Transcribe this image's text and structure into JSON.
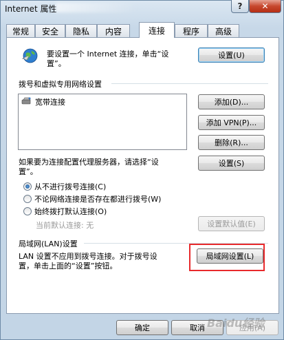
{
  "window": {
    "title": "Internet 属性",
    "help_label": "?",
    "close_label": "✕"
  },
  "tabs": [
    {
      "label": "常规"
    },
    {
      "label": "安全"
    },
    {
      "label": "隐私"
    },
    {
      "label": "内容"
    },
    {
      "label": "连接"
    },
    {
      "label": "程序"
    },
    {
      "label": "高级"
    }
  ],
  "setup": {
    "text_line1": "要设置一个 Internet 连接，单击“设",
    "text_line2": "置”。",
    "button": "设置(U)"
  },
  "dialup": {
    "group_label": "拨号和虚拟专用网络设置",
    "items": [
      "宽带连接"
    ],
    "add_button": "添加(D)...",
    "add_vpn_button": "添加 VPN(P)...",
    "delete_button": "删除(R)...",
    "proxy_text_line1": "如果要为连接配置代理服务器，请选择“设",
    "proxy_text_line2": "置”。",
    "settings_button": "设置(S)",
    "radio_options": [
      {
        "label": "从不进行拨号连接(C)",
        "selected": true
      },
      {
        "label": "不论网络连接是否存在都进行拨号(W)",
        "selected": false
      },
      {
        "label": "始终拨打默认连接(O)",
        "selected": false
      }
    ],
    "current_default": "当前默认连接:   无",
    "set_default_button": "设置默认值(E)"
  },
  "lan": {
    "group_label": "局域网(LAN)设置",
    "text_line1": "LAN 设置不应用到拨号连接。对于拨号设",
    "text_line2": "置，单击上面的“设置”按钮。",
    "button": "局域网设置(L)"
  },
  "footer": {
    "ok_button": "确定",
    "cancel_button": "取消",
    "apply_button": "应用(A)"
  },
  "watermark": "Baidu经验"
}
